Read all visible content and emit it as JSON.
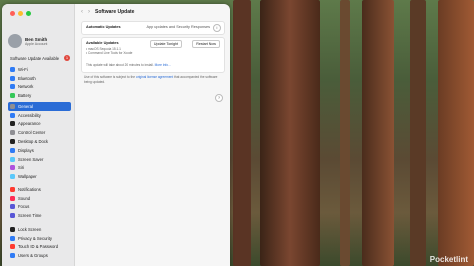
{
  "window": {
    "title": "Software Update"
  },
  "user": {
    "name": "Ben Smith",
    "subtitle": "Apple Account"
  },
  "sidebar": {
    "update_banner": "Software Update Available",
    "update_badge": "1",
    "groups": [
      [
        {
          "label": "Wi-Fi",
          "icon": "wifi-icon",
          "color": "#2f7bf5"
        },
        {
          "label": "Bluetooth",
          "icon": "bluetooth-icon",
          "color": "#2f7bf5"
        },
        {
          "label": "Network",
          "icon": "globe-icon",
          "color": "#2f7bf5"
        },
        {
          "label": "Battery",
          "icon": "battery-icon",
          "color": "#34c759"
        }
      ],
      [
        {
          "label": "General",
          "icon": "gear-icon",
          "color": "#8e8e93",
          "selected": true
        },
        {
          "label": "Accessibility",
          "icon": "accessibility-icon",
          "color": "#2f7bf5"
        },
        {
          "label": "Appearance",
          "icon": "appearance-icon",
          "color": "#222222"
        },
        {
          "label": "Control Center",
          "icon": "control-center-icon",
          "color": "#8e8e93"
        },
        {
          "label": "Desktop & Dock",
          "icon": "dock-icon",
          "color": "#222222"
        },
        {
          "label": "Displays",
          "icon": "display-icon",
          "color": "#2f7bf5"
        },
        {
          "label": "Screen Saver",
          "icon": "screensaver-icon",
          "color": "#5ac8fa"
        },
        {
          "label": "Siri",
          "icon": "siri-icon",
          "color": "#af52de"
        },
        {
          "label": "Wallpaper",
          "icon": "wallpaper-icon",
          "color": "#5ac8fa"
        }
      ],
      [
        {
          "label": "Notifications",
          "icon": "bell-icon",
          "color": "#ff3b30"
        },
        {
          "label": "Sound",
          "icon": "speaker-icon",
          "color": "#ff2d55"
        },
        {
          "label": "Focus",
          "icon": "moon-icon",
          "color": "#5856d6"
        },
        {
          "label": "Screen Time",
          "icon": "hourglass-icon",
          "color": "#5856d6"
        }
      ],
      [
        {
          "label": "Lock Screen",
          "icon": "lock-icon",
          "color": "#222222"
        },
        {
          "label": "Privacy & Security",
          "icon": "hand-icon",
          "color": "#2f7bf5"
        },
        {
          "label": "Touch ID & Password",
          "icon": "fingerprint-icon",
          "color": "#ff3b30"
        },
        {
          "label": "Users & Groups",
          "icon": "users-icon",
          "color": "#2f7bf5"
        }
      ]
    ]
  },
  "automatic_updates": {
    "label": "Automatic Updates",
    "value": "App updates and Security Responses",
    "info": "i"
  },
  "available": {
    "title": "Available Updates",
    "lines": [
      "• macOS Sequoia 15.1.1",
      "• Command Line Tools for Xcode"
    ],
    "update_button": "Update Tonight",
    "restart_button": "Restart Now",
    "note": "This update will take about 20 minutes to install.",
    "more_info": "More Info..."
  },
  "license": {
    "text_before": "Use of this software is subject to the",
    "link": "original license agreement",
    "text_after": "that accompanied the software being updated."
  },
  "help": "?",
  "watermark": "Pocketlint",
  "colors": {
    "close": "#ff5f57",
    "minimize": "#febc2e",
    "zoom": "#28c840",
    "accent": "#2a6cd6"
  }
}
